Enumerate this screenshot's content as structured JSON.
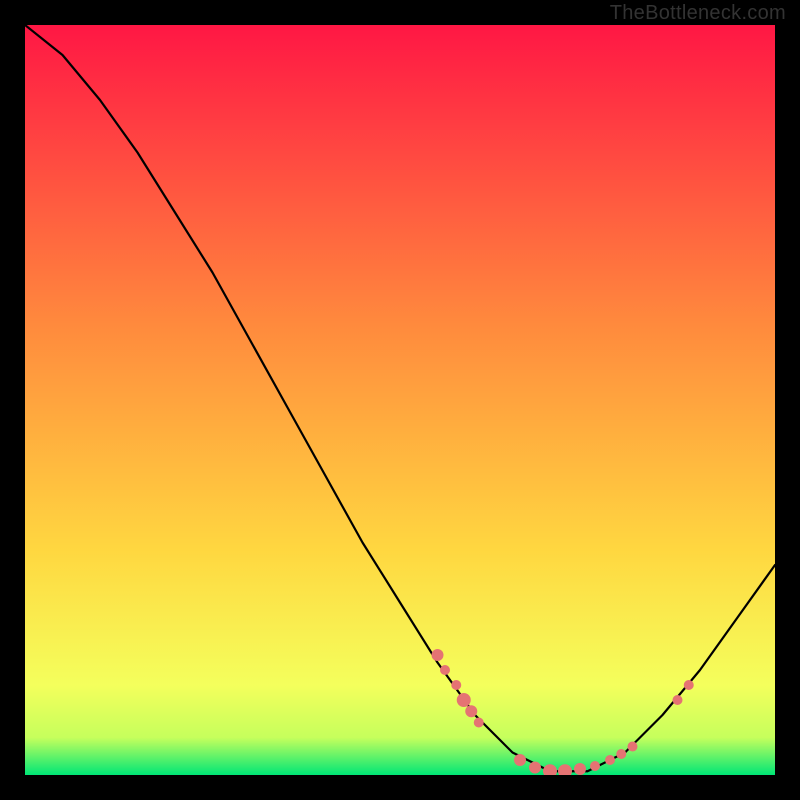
{
  "watermark": "TheBottleneck.com",
  "chart_data": {
    "type": "line",
    "title": "",
    "xlabel": "",
    "ylabel": "",
    "xlim": [
      0,
      100
    ],
    "ylim": [
      0,
      100
    ],
    "curve": [
      {
        "x": 0,
        "y": 100
      },
      {
        "x": 5,
        "y": 96
      },
      {
        "x": 10,
        "y": 90
      },
      {
        "x": 15,
        "y": 83
      },
      {
        "x": 20,
        "y": 75
      },
      {
        "x": 25,
        "y": 67
      },
      {
        "x": 30,
        "y": 58
      },
      {
        "x": 35,
        "y": 49
      },
      {
        "x": 40,
        "y": 40
      },
      {
        "x": 45,
        "y": 31
      },
      {
        "x": 50,
        "y": 23
      },
      {
        "x": 55,
        "y": 15
      },
      {
        "x": 60,
        "y": 8
      },
      {
        "x": 65,
        "y": 3
      },
      {
        "x": 70,
        "y": 0.5
      },
      {
        "x": 75,
        "y": 0.5
      },
      {
        "x": 80,
        "y": 3
      },
      {
        "x": 85,
        "y": 8
      },
      {
        "x": 90,
        "y": 14
      },
      {
        "x": 95,
        "y": 21
      },
      {
        "x": 100,
        "y": 28
      }
    ],
    "marker_clusters": [
      {
        "x": 55,
        "y": 16,
        "size": 6
      },
      {
        "x": 56,
        "y": 14,
        "size": 5
      },
      {
        "x": 57.5,
        "y": 12,
        "size": 5
      },
      {
        "x": 58.5,
        "y": 10,
        "size": 7
      },
      {
        "x": 59.5,
        "y": 8.5,
        "size": 6
      },
      {
        "x": 60.5,
        "y": 7,
        "size": 5
      },
      {
        "x": 66,
        "y": 2,
        "size": 6
      },
      {
        "x": 68,
        "y": 1,
        "size": 6
      },
      {
        "x": 70,
        "y": 0.5,
        "size": 7
      },
      {
        "x": 72,
        "y": 0.5,
        "size": 7
      },
      {
        "x": 74,
        "y": 0.8,
        "size": 6
      },
      {
        "x": 76,
        "y": 1.2,
        "size": 5
      },
      {
        "x": 78,
        "y": 2,
        "size": 5
      },
      {
        "x": 79.5,
        "y": 2.8,
        "size": 5
      },
      {
        "x": 81,
        "y": 3.8,
        "size": 5
      },
      {
        "x": 87,
        "y": 10,
        "size": 5
      },
      {
        "x": 88.5,
        "y": 12,
        "size": 5
      }
    ],
    "gradient_stops": [
      {
        "offset": 0,
        "color": "#ff1744"
      },
      {
        "offset": 40,
        "color": "#ff8a3d"
      },
      {
        "offset": 70,
        "color": "#ffd740"
      },
      {
        "offset": 88,
        "color": "#f4ff5c"
      },
      {
        "offset": 95,
        "color": "#c6ff5c"
      },
      {
        "offset": 100,
        "color": "#00e676"
      }
    ],
    "marker_color": "#e57373",
    "curve_color": "#000000"
  }
}
